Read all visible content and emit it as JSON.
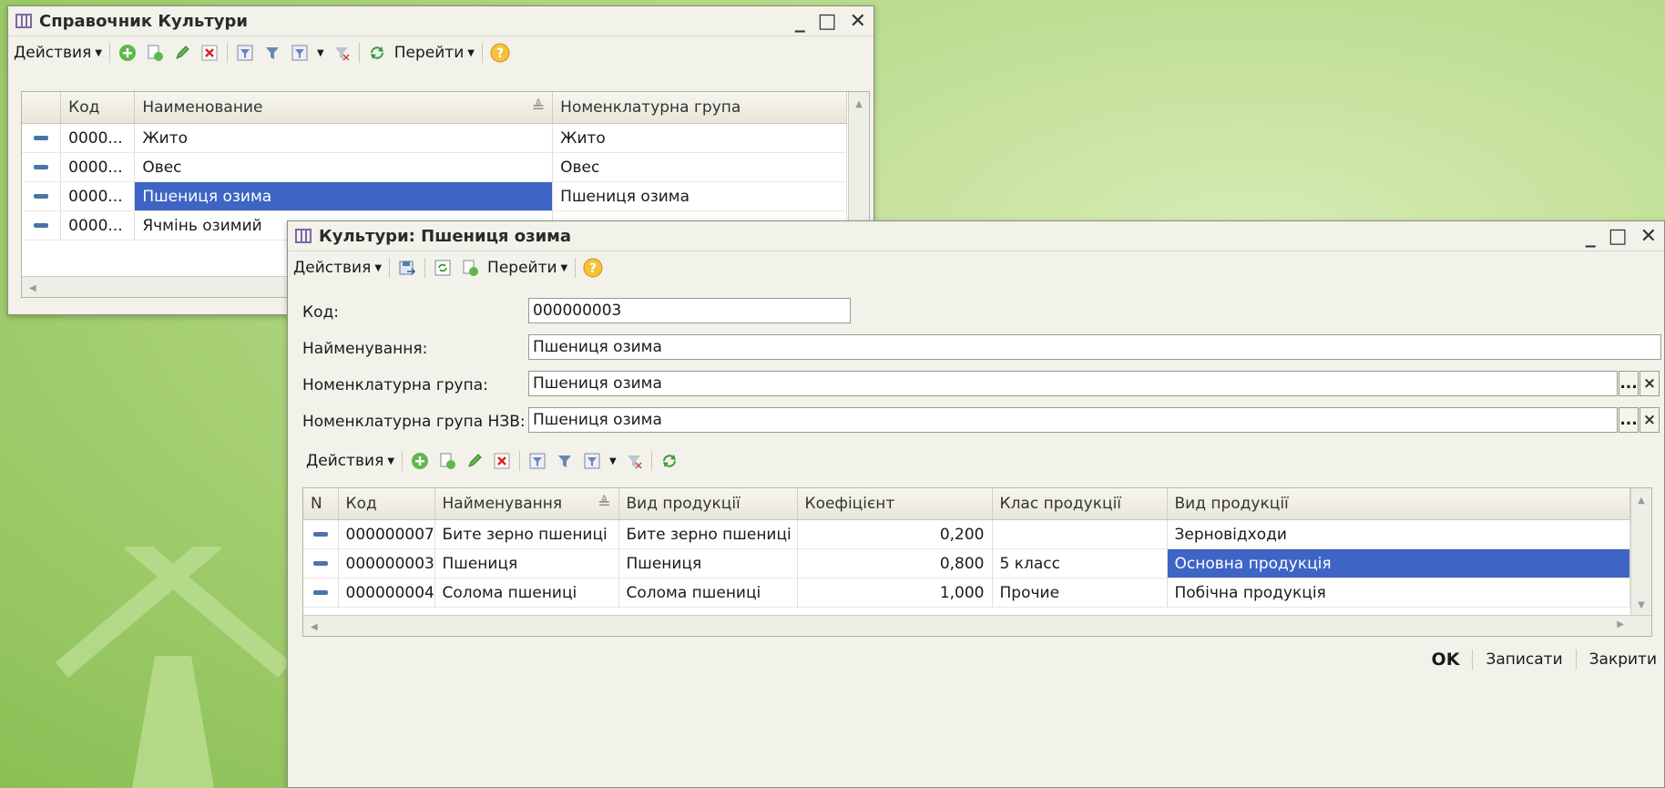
{
  "window1": {
    "title": "Справочник Культури",
    "toolbar": {
      "actions_label": "Действия",
      "goto_label": "Перейти"
    },
    "columns": [
      "Код",
      "Наименование",
      "Номенклатурна група"
    ],
    "rows": [
      {
        "code": "0000...",
        "name": "Жито",
        "group": "Жито"
      },
      {
        "code": "0000...",
        "name": "Овес",
        "group": "Овес"
      },
      {
        "code": "0000...",
        "name": "Пшениця озима",
        "group": "Пшениця озима"
      },
      {
        "code": "0000...",
        "name": "Ячмінь озимий",
        "group": ""
      }
    ],
    "selected_row": 2
  },
  "window2": {
    "title": "Культури: Пшениця озима",
    "toolbar": {
      "actions_label": "Действия",
      "goto_label": "Перейти"
    },
    "fields": {
      "code_label": "Код:",
      "code_value": "000000003",
      "name_label": "Найменування:",
      "name_value": "Пшениця озима",
      "group_label": "Номенклатурна група:",
      "group_value": "Пшениця озима",
      "group_nzv_label": "Номенклатурна група НЗВ:",
      "group_nzv_value": "Пшениця озима",
      "select_button": "...",
      "clear_button": "×"
    },
    "table_toolbar": {
      "actions_label": "Действия"
    },
    "columns": [
      "N",
      "Код",
      "Найменування",
      "Вид продукції",
      "Коефіцієнт",
      "Клас продукції",
      "Вид продукції"
    ],
    "rows": [
      {
        "code": "000000007",
        "name": "Бите зерно пшениці",
        "kind": "Бите зерно пшениці",
        "coef": "0,200",
        "class": "",
        "ptype": "Зерновідходи"
      },
      {
        "code": "000000003",
        "name": "Пшениця",
        "kind": "Пшениця",
        "coef": "0,800",
        "class": "5 класс",
        "ptype": "Основна продукція"
      },
      {
        "code": "000000004",
        "name": "Солома пшениці",
        "kind": "Солома пшениці",
        "coef": "1,000",
        "class": "Прочие",
        "ptype": "Побічна продукція"
      }
    ],
    "footer": {
      "ok": "OK",
      "save": "Записати",
      "close": "Закрити"
    }
  },
  "window_controls": {
    "minimize": "_",
    "maximize": "□",
    "close": "✕"
  },
  "colors": {
    "selection": "#3e64c6",
    "window_bg": "#f2f1ea",
    "background_green": "#9fcc6b"
  },
  "icons": [
    "add-icon",
    "copy-icon",
    "edit-icon",
    "delete-icon",
    "filter-icon",
    "filter-by-value-icon",
    "filter-list-icon",
    "clear-filter-icon",
    "refresh-icon",
    "help-icon"
  ]
}
